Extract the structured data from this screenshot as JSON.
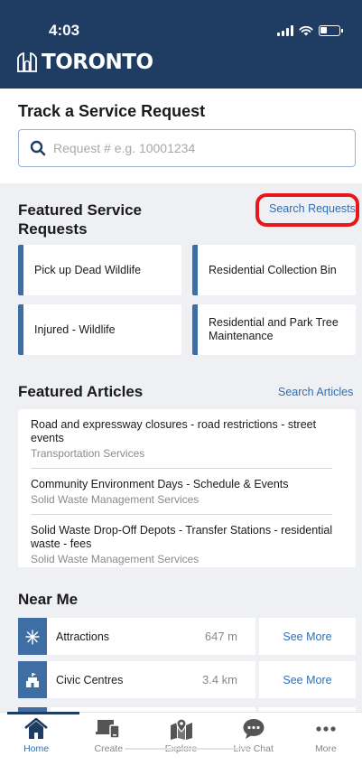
{
  "status": {
    "time": "4:03"
  },
  "brand": {
    "logo_text": "TORONTO"
  },
  "track": {
    "title": "Track a Service Request",
    "placeholder": "Request # e.g. 10001234"
  },
  "featured_requests": {
    "title": "Featured Service Requests",
    "link": "Search Requests",
    "cards": [
      {
        "label": "Pick up Dead Wildlife"
      },
      {
        "label": "Residential Collection Bin"
      },
      {
        "label": "Injured - Wildlife"
      },
      {
        "label": "Residential and Park Tree Maintenance"
      }
    ]
  },
  "featured_articles": {
    "title": "Featured Articles",
    "link": "Search Articles",
    "items": [
      {
        "title": "Road and expressway closures - road restrictions - street events",
        "source": "Transportation Services"
      },
      {
        "title": "Community Environment Days - Schedule & Events",
        "source": "Solid Waste Management Services"
      },
      {
        "title": "Solid Waste Drop-Off Depots - Transfer Stations - residential waste - fees",
        "source": "Solid Waste Management Services"
      }
    ]
  },
  "near_me": {
    "title": "Near Me",
    "items": [
      {
        "name": "Attractions",
        "distance": "647 m",
        "more": "See More",
        "icon": "fireworks-icon"
      },
      {
        "name": "Civic Centres",
        "distance": "3.4 km",
        "more": "See More",
        "icon": "civic-building-icon"
      }
    ]
  },
  "tabs": [
    {
      "label": "Home",
      "icon": "home-icon",
      "active": true
    },
    {
      "label": "Create",
      "icon": "create-icon",
      "active": false
    },
    {
      "label": "Explore",
      "icon": "map-icon",
      "active": false
    },
    {
      "label": "Live Chat",
      "icon": "chat-bubble-icon",
      "active": false
    },
    {
      "label": "More",
      "icon": "more-dots-icon",
      "active": false
    }
  ],
  "colors": {
    "header": "#1f3d63",
    "accent": "#3f6ea5",
    "link": "#2f6fb6",
    "highlight": "#e8171b",
    "section_bg": "#eef0f3"
  }
}
